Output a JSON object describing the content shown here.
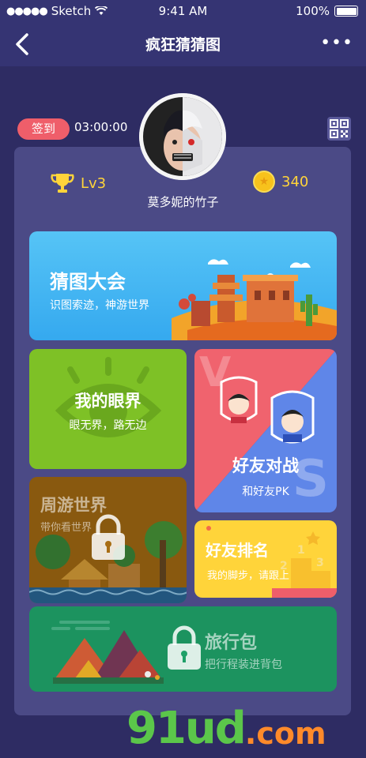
{
  "status": {
    "carrier": "Sketch",
    "time": "9:41 AM",
    "battery": "100%"
  },
  "nav": {
    "title": "疯狂猜猜图",
    "more": "•••"
  },
  "profile": {
    "checkin": "签到",
    "timer": "03:00:00",
    "level": "Lv3",
    "coins": "340",
    "username": "莫多妮的竹子"
  },
  "cards": {
    "guess": {
      "title": "猜图大会",
      "subtitle": "识图索迹，神游世界"
    },
    "vision": {
      "title": "我的眼界",
      "subtitle": "眼无界，路无边"
    },
    "battle": {
      "title": "好友对战",
      "subtitle": "和好友PK",
      "vs_v": "V",
      "vs_s": "S"
    },
    "travel": {
      "title": "周游世界",
      "subtitle": "带你看世界"
    },
    "rank": {
      "title": "好友排名",
      "subtitle": "我的脚步，请跟上",
      "podium": [
        "1",
        "2",
        "3"
      ]
    },
    "bag": {
      "title": "旅行包",
      "subtitle": "把行程装进背包"
    }
  },
  "watermark": {
    "main": "91ud",
    "suffix": ".com"
  },
  "colors": {
    "background": "#2e2c63",
    "panel": "#4b4a86",
    "accent_red": "#ef5e6a",
    "gold": "#ffd43a"
  }
}
